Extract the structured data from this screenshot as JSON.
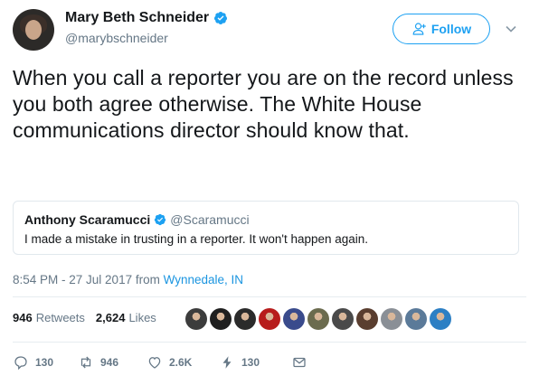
{
  "author": {
    "display_name": "Mary Beth Schneider",
    "handle": "@marybschneider",
    "avatar_icon": "profile-photo",
    "verified_icon": "verified-badge-icon"
  },
  "follow_button": {
    "label": "Follow",
    "icon": "add-person-icon"
  },
  "tweet_text": "When you call a reporter you are on the record unless you both agree otherwise. The White House communications director should know that.",
  "quoted_tweet": {
    "display_name": "Anthony Scaramucci",
    "handle": "@Scaramucci",
    "text": "I made a mistake in trusting in a reporter. It won't happen again."
  },
  "meta": {
    "timestamp": "8:54 PM - 27 Jul 2017 from ",
    "location": "Wynnedale, IN"
  },
  "stats": {
    "retweets_count": "946",
    "retweets_label": "Retweets",
    "likes_count": "2,624",
    "likes_label": "Likes",
    "liker_colors": [
      "#3c3c3c",
      "#1f1f1f",
      "#2b2b2b",
      "#b71c1c",
      "#3a4b8c",
      "#6b6b4e",
      "#4a4a4a",
      "#5a3e2f",
      "#8a8f96",
      "#5b7a99",
      "#2c7fc4"
    ]
  },
  "actions": {
    "reply_count": "130",
    "retweet_count": "946",
    "like_count": "2.6K",
    "moments_count": "130"
  },
  "colors": {
    "accent": "#1da1f2",
    "link": "#1b95e0",
    "muted": "#657786",
    "border": "#e1e8ed"
  }
}
